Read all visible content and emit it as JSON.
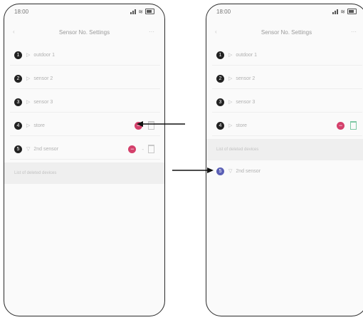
{
  "phones": [
    {
      "status_time": "18:00",
      "nav_title": "Sensor No. Settings",
      "rows": [
        {
          "name": "outdoor 1",
          "removable": false
        },
        {
          "name": "sensor 2",
          "removable": false
        },
        {
          "name": "sensor 3",
          "removable": false
        },
        {
          "name": "store",
          "removable": true
        },
        {
          "name": "2nd sensor",
          "removable": true
        }
      ],
      "section_label": "List of deleted devices"
    },
    {
      "status_time": "18:00",
      "nav_title": "Sensor No. Settings",
      "rows": [
        {
          "name": "outdoor 1",
          "removable": false
        },
        {
          "name": "sensor 2",
          "removable": false
        },
        {
          "name": "sensor 3",
          "removable": false
        },
        {
          "name": "store",
          "removable": true
        }
      ],
      "section_label": "List of deleted devices",
      "deleted_rows": [
        {
          "name": "2nd sensor"
        }
      ]
    }
  ],
  "colors": {
    "remove_button": "#d4406b",
    "deleted_indicator": "#5a5fb5",
    "arrow": "#111111"
  },
  "icons": [
    "signal-icon",
    "wifi-icon",
    "battery-icon",
    "back-icon",
    "more-icon",
    "remove-icon",
    "trash-icon",
    "arrow-icon"
  ]
}
